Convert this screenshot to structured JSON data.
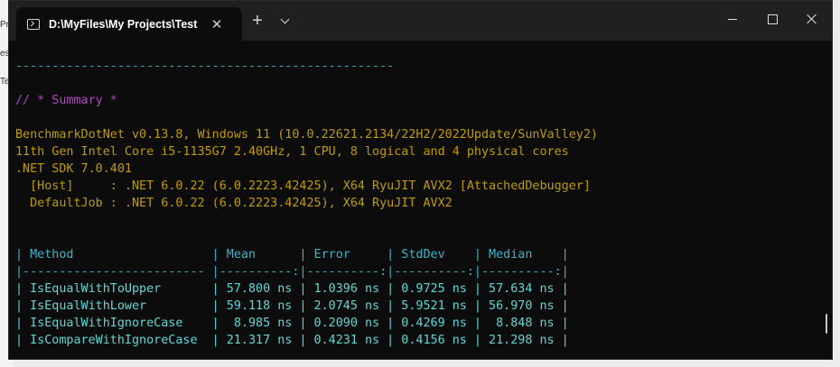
{
  "background": {
    "edge_chars": [
      "Pr",
      "es",
      "Te"
    ]
  },
  "window": {
    "tab_title": "D:\\MyFiles\\My Projects\\TestPr",
    "tab_close": "✕",
    "new_tab": "+"
  },
  "terminal": {
    "lines": [
      {
        "text": "",
        "color": "yellow"
      },
      {
        "text": "----------------------------------------------------",
        "color": "cyan"
      },
      {
        "text": "",
        "color": "yellow"
      },
      {
        "text": "// * Summary *",
        "color": "magenta"
      },
      {
        "text": "",
        "color": "yellow"
      },
      {
        "text": "BenchmarkDotNet v0.13.8, Windows 11 (10.0.22621.2134/22H2/2022Update/SunValley2)",
        "color": "yellow"
      },
      {
        "text": "11th Gen Intel Core i5-1135G7 2.40GHz, 1 CPU, 8 logical and 4 physical cores",
        "color": "yellow"
      },
      {
        "text": ".NET SDK 7.0.401",
        "color": "yellow"
      },
      {
        "text": "  [Host]     : .NET 6.0.22 (6.0.2223.42425), X64 RyuJIT AVX2 [AttachedDebugger]",
        "color": "yellow"
      },
      {
        "text": "  DefaultJob : .NET 6.0.22 (6.0.2223.42425), X64 RyuJIT AVX2",
        "color": "yellow"
      },
      {
        "text": "",
        "color": "yellow"
      },
      {
        "text": "",
        "color": "yellow"
      },
      {
        "text": "| Method                   | Mean      | Error     | StdDev    | Median    |",
        "color": "cyan"
      },
      {
        "text": "|------------------------- |----------:|----------:|----------:|----------:|",
        "color": "cyan"
      },
      {
        "text": "| IsEqualWithToUpper       | 57.800 ns | 1.0396 ns | 0.9725 ns | 57.634 ns |",
        "color": "cyan-bright"
      },
      {
        "text": "| IsEqualWithLower         | 59.118 ns | 2.0745 ns | 5.9521 ns | 56.970 ns |",
        "color": "cyan-bright"
      },
      {
        "text": "| IsEqualWithIgnoreCase    |  8.985 ns | 0.2090 ns | 0.4269 ns |  8.848 ns |",
        "color": "cyan-bright"
      },
      {
        "text": "| IsCompareWithIgnoreCase  | 21.317 ns | 0.4231 ns | 0.4156 ns | 21.298 ns |",
        "color": "cyan-bright"
      }
    ]
  }
}
